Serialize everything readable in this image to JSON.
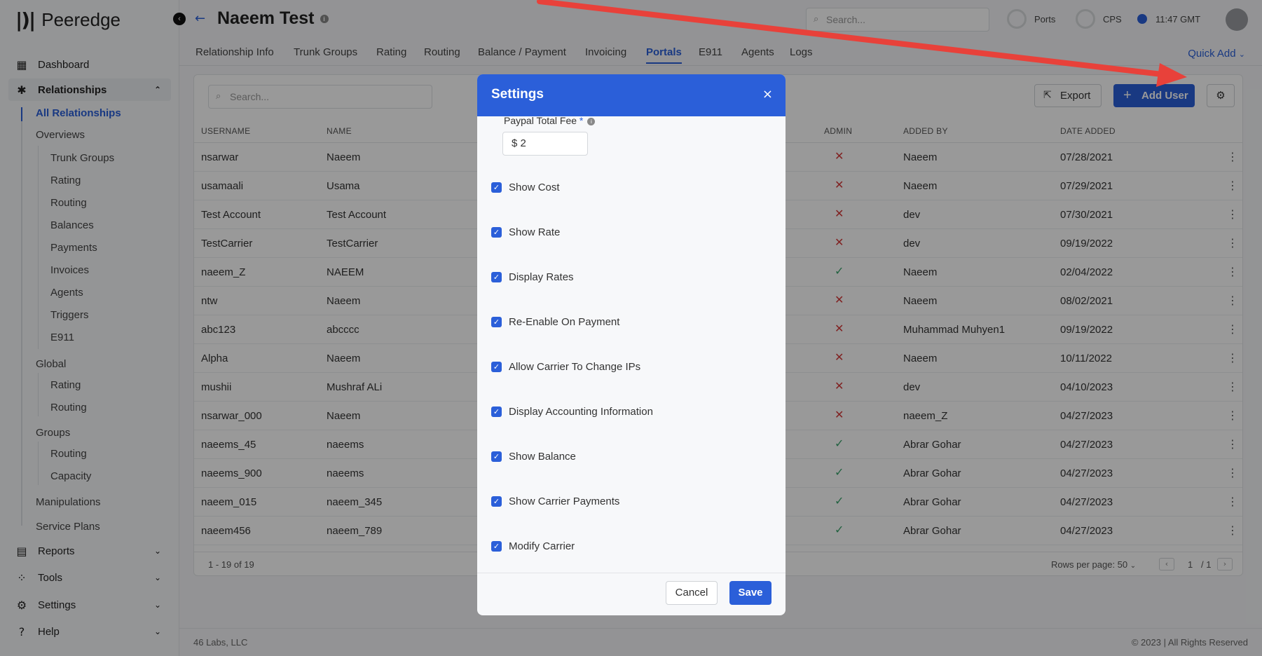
{
  "app": {
    "logo_mark": "|)|",
    "name": "Peeredge"
  },
  "sidebar": {
    "dashboard": "Dashboard",
    "relationships": "Relationships",
    "all_relationships": "All Relationships",
    "overviews": "Overviews",
    "overview_items": [
      "Trunk Groups",
      "Rating",
      "Routing",
      "Balances",
      "Payments",
      "Invoices",
      "Agents",
      "Triggers",
      "E911"
    ],
    "global": "Global",
    "global_items": [
      "Rating",
      "Routing"
    ],
    "groups": "Groups",
    "group_items": [
      "Routing",
      "Capacity"
    ],
    "manipulations": "Manipulations",
    "service_plans": "Service Plans",
    "reports": "Reports",
    "tools": "Tools",
    "settings": "Settings",
    "help": "Help"
  },
  "header": {
    "title": "Naeem Test",
    "search_placeholder": "Search...",
    "ports_label": "Ports",
    "cps_label": "CPS",
    "time": "11:47 GMT"
  },
  "tabs": [
    "Relationship Info",
    "Trunk Groups",
    "Rating",
    "Routing",
    "Balance / Payment",
    "Invoicing",
    "Portals",
    "E911",
    "Agents",
    "Logs"
  ],
  "active_tab": "Portals",
  "quick_add": "Quick Add",
  "table": {
    "search_placeholder": "Search...",
    "export_label": "Export",
    "add_user_label": "Add User",
    "columns": [
      "USERNAME",
      "NAME",
      "ADMIN",
      "ADDED BY",
      "DATE ADDED"
    ],
    "rows": [
      {
        "username": "nsarwar",
        "name": "Naeem",
        "admin": false,
        "added_by": "Naeem",
        "date": "07/28/2021"
      },
      {
        "username": "usamaali",
        "name": "Usama",
        "admin": false,
        "added_by": "Naeem",
        "date": "07/29/2021"
      },
      {
        "username": "Test Account",
        "name": "Test Account",
        "admin": false,
        "added_by": "dev",
        "date": "07/30/2021"
      },
      {
        "username": "TestCarrier",
        "name": "TestCarrier",
        "admin": false,
        "added_by": "dev",
        "date": "09/19/2022"
      },
      {
        "username": "naeem_Z",
        "name": "NAEEM",
        "admin": true,
        "added_by": "Naeem",
        "date": "02/04/2022"
      },
      {
        "username": "ntw",
        "name": "Naeem",
        "admin": false,
        "added_by": "Naeem",
        "date": "08/02/2021"
      },
      {
        "username": "abc123",
        "name": "abcccc",
        "admin": false,
        "added_by": "Muhammad Muhyen1",
        "date": "09/19/2022"
      },
      {
        "username": "Alpha",
        "name": "Naeem",
        "admin": false,
        "added_by": "Naeem",
        "date": "10/11/2022"
      },
      {
        "username": "mushii",
        "name": "Mushraf ALi",
        "admin": false,
        "added_by": "dev",
        "date": "04/10/2023"
      },
      {
        "username": "nsarwar_000",
        "name": "Naeem",
        "admin": false,
        "added_by": "naeem_Z",
        "date": "04/27/2023"
      },
      {
        "username": "naeems_45",
        "name": "naeems",
        "admin": true,
        "added_by": "Abrar Gohar",
        "date": "04/27/2023"
      },
      {
        "username": "naeems_900",
        "name": "naeems",
        "admin": true,
        "added_by": "Abrar Gohar",
        "date": "04/27/2023"
      },
      {
        "username": "naeem_015",
        "name": "naeem_345",
        "admin": true,
        "added_by": "Abrar Gohar",
        "date": "04/27/2023"
      },
      {
        "username": "naeem456",
        "name": "naeem_789",
        "admin": true,
        "added_by": "Abrar Gohar",
        "date": "04/27/2023"
      }
    ],
    "range": "1 - 19 of 19",
    "rows_per_page": "Rows per page: 50",
    "page": "1",
    "page_total": "/ 1"
  },
  "footer": {
    "left": "46 Labs, LLC",
    "right": "© 2023 | All Rights Reserved"
  },
  "modal": {
    "title": "Settings",
    "fee_label": "Paypal Total Fee",
    "fee_value": "$ 2",
    "checkboxes": [
      "Show Cost",
      "Show Rate",
      "Display Rates",
      "Re-Enable On Payment",
      "Allow Carrier To Change IPs",
      "Display Accounting Information",
      "Show Balance",
      "Show Carrier Payments",
      "Modify Carrier"
    ],
    "cancel": "Cancel",
    "save": "Save"
  },
  "colors": {
    "accent": "#2b5fd9",
    "arrow": "#e8413a",
    "error": "#d63a3a",
    "success": "#3aa36c"
  }
}
